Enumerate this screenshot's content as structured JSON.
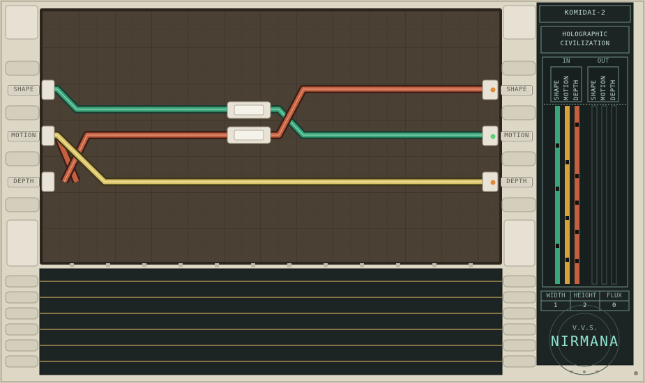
{
  "puzzle": {
    "name": "KOMIDAI-2",
    "title_line1": "HOLOGRAPHIC",
    "title_line2": "CIVILIZATION"
  },
  "ports": {
    "left": [
      "SHAPE",
      "MOTION",
      "DEPTH"
    ],
    "right": [
      "SHAPE",
      "MOTION",
      "DEPTH"
    ]
  },
  "io_panel": {
    "in_label": "IN",
    "out_label": "OUT",
    "in_channels": [
      "SHAPE",
      "MOTION",
      "DEPTH"
    ],
    "out_channels": [
      "SHAPE",
      "MOTION",
      "DEPTH"
    ]
  },
  "stats": {
    "headers": [
      "WIDTH",
      "HEIGHT",
      "FLUX"
    ],
    "values": [
      "1",
      "2",
      "0"
    ]
  },
  "brand": {
    "small": "V.V.S.",
    "name": "NIRMANA"
  },
  "colors": {
    "board": "#4a3f33",
    "shape_wire": "#3aa57a",
    "motion_wire": "#c2603f",
    "depth_wire": "#d8c26a",
    "frame": "#ddd7c6",
    "panel": "#1c2524"
  }
}
